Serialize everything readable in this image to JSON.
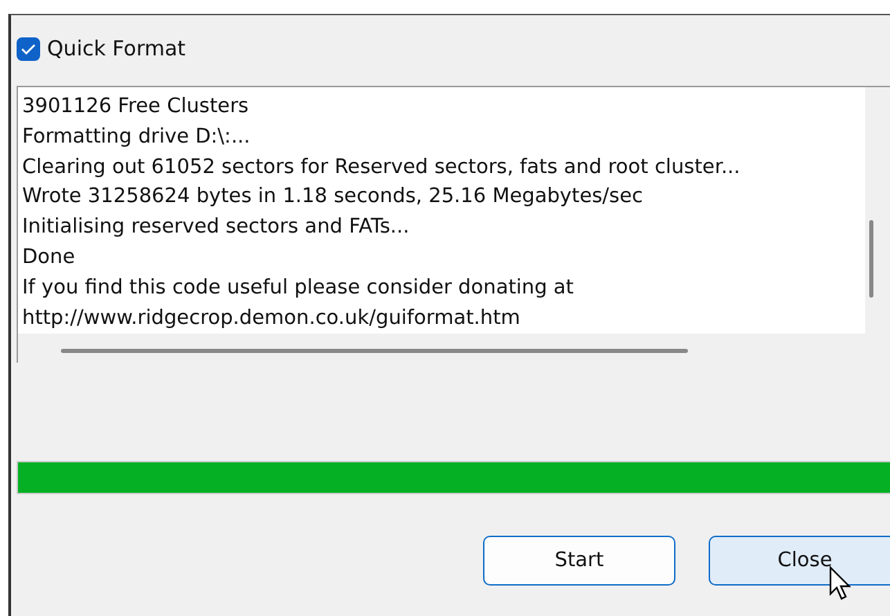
{
  "quick_format": {
    "label": "Quick Format",
    "checked": true
  },
  "log": {
    "lines": [
      "3901126 Free Clusters",
      "Formatting drive D:\\:...",
      "Clearing out 61052 sectors for Reserved sectors, fats and root cluster...",
      "Wrote 31258624 bytes in 1.18 seconds, 25.16 Megabytes/sec",
      "Initialising reserved sectors and FATs...",
      "Done",
      "If you find this code useful please consider donating at",
      "http://www.ridgecrop.demon.co.uk/guiformat.htm"
    ]
  },
  "progress": {
    "level": 1
  },
  "buttons": [
    {
      "label": "Start",
      "hovered": false
    },
    {
      "label": "Close",
      "hovered": true
    }
  ]
}
